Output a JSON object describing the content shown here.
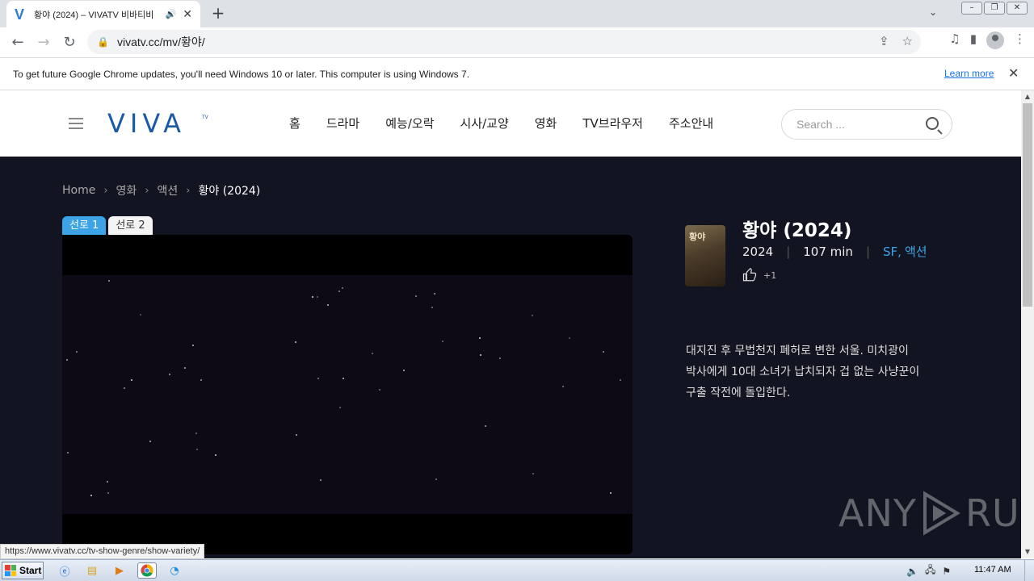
{
  "browser": {
    "tab_title": "황야 (2024) – VIVATV 비바티비",
    "tab_favicon": "V",
    "audio_icon": "speaker-icon",
    "close_glyph": "✕",
    "new_tab_glyph": "+",
    "tab_search_glyph": "⌄",
    "window_controls": {
      "minimize": "–",
      "restore": "❐",
      "close": "✕"
    },
    "url": "vivatv.cc/mv/황야/",
    "nav": {
      "back": "←",
      "forward": "→",
      "reload": "↻"
    },
    "omnibox_icons": {
      "share": "⇪",
      "bookmark": "☆"
    },
    "toolbar_icons": {
      "media": "♫",
      "side_panel": "▮",
      "menu": "⋮"
    }
  },
  "infobar": {
    "message": "To get future Google Chrome updates, you'll need Windows 10 or later. This computer is using Windows 7.",
    "link": "Learn more",
    "close": "✕"
  },
  "site": {
    "logo": "VIVA",
    "logo_superscript": "TV",
    "nav": [
      "홈",
      "드라마",
      "예능/오락",
      "시사/교양",
      "영화",
      "TV브라우저",
      "주소안내"
    ],
    "search_placeholder": "Search ..."
  },
  "breadcrumb": {
    "items": [
      "Home",
      "영화",
      "액션"
    ],
    "current": "황야 (2024)",
    "separator": "›"
  },
  "player": {
    "server_tabs": [
      "선로 1",
      "선로 2"
    ],
    "active_tab": 0
  },
  "movie": {
    "poster_text": "황야",
    "title": "황야 (2024)",
    "year": "2024",
    "runtime": "107 min",
    "genres": [
      "SF",
      "액션"
    ],
    "likes": "+1",
    "synopsis": "대지진 후 무법천지 폐허로 변한 서울. 미치광이 박사에게 10대 소녀가 납치되자 겁 없는 사냥꾼이 구출 작전에 돌입한다."
  },
  "watermark": {
    "left": "ANY",
    "right": "RUN"
  },
  "status_bar_url": "https://www.vivatv.cc/tv-show-genre/show-variety/",
  "scrollbar": {
    "up": "▲",
    "down": "▼"
  },
  "taskbar": {
    "start_label": "Start",
    "clock": "11:47 AM",
    "tray_icons": {
      "volume": "🔈",
      "network": "🖧",
      "flag": "⚑"
    }
  },
  "colors": {
    "accent": "#3ba3e6",
    "page_bg": "#121521",
    "logo": "#1b5aa6"
  }
}
